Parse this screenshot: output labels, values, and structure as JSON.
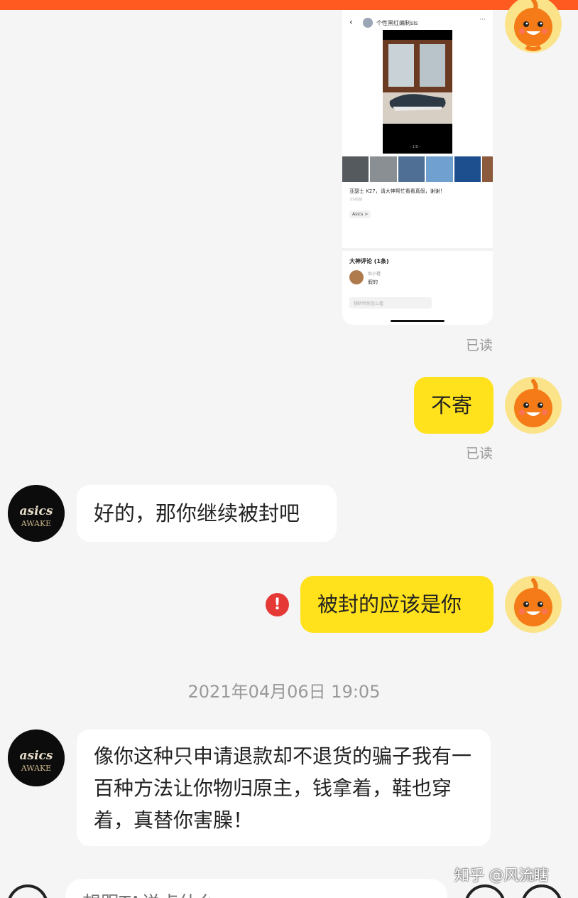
{
  "screenshot_card": {
    "header_name": "个性黑红编制sls",
    "back_icon": "‹",
    "more_icon": "···",
    "title": "亚瑟士 K27，请大神帮忙看看真假，谢谢！",
    "subtitle": "3小时前",
    "tag": "Asics >",
    "comments_header": "大神评论 (1条)",
    "comment_user": "怡小橙",
    "comment_text": "假的",
    "comment_input_placeholder": "想听听你怎么看"
  },
  "messages": [
    {
      "read_status": "已读"
    },
    {
      "text": "不寄",
      "read_status": "已读"
    },
    {
      "text": "好的，那你继续被封吧"
    },
    {
      "text": "被封的应该是你",
      "alert": "!"
    },
    {
      "text": "像你这种只申请退款却不退货的骗子我有一百种方法让你物归原主，钱拿着，鞋也穿着，真替你害臊！"
    }
  ],
  "timestamp": "2021年04月06日 19:05",
  "watermark": "知乎 @风流瞎",
  "input": {
    "placeholder": "想跟TA说点什么"
  },
  "icons": {
    "mine_avatar": "orange-mascot-avatar",
    "their_avatar": "asics-awake-avatar",
    "alert": "exclamation-icon",
    "voice": "voice-icon",
    "emoji": "emoji-icon",
    "plus": "plus-icon"
  },
  "colors": {
    "top_bar": "#ff5a1f",
    "my_bubble": "#ffe11c",
    "alert": "#e53935"
  }
}
